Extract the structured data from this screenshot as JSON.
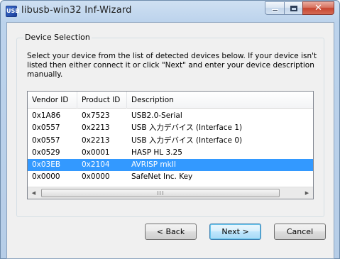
{
  "window": {
    "title": "libusb-win32 Inf-Wizard",
    "icon": "libusb-app-icon",
    "icon_text": "USB"
  },
  "group": {
    "label": "Device Selection",
    "instructions": "Select your device from the list of detected devices below. If your device isn't listed then either connect it or click \"Next\" and enter your device description manually."
  },
  "list": {
    "columns": [
      "Vendor ID",
      "Product ID",
      "Description"
    ],
    "rows": [
      {
        "vendor": "0x1A86",
        "product": "0x7523",
        "description": "USB2.0-Serial",
        "selected": false
      },
      {
        "vendor": "0x0557",
        "product": "0x2213",
        "description": "USB 入力デバイス (Interface 1)",
        "selected": false
      },
      {
        "vendor": "0x0557",
        "product": "0x2213",
        "description": "USB 入力デバイス (Interface 0)",
        "selected": false
      },
      {
        "vendor": "0x0529",
        "product": "0x0001",
        "description": "HASP HL 3.25",
        "selected": false
      },
      {
        "vendor": "0x03EB",
        "product": "0x2104",
        "description": "AVRISP mkII",
        "selected": true
      },
      {
        "vendor": "0x0000",
        "product": "0x0000",
        "description": "SafeNet Inc. Key",
        "selected": false
      }
    ],
    "selection_color": "#3399ff"
  },
  "buttons": {
    "back": "< Back",
    "next": "Next >",
    "cancel": "Cancel"
  }
}
